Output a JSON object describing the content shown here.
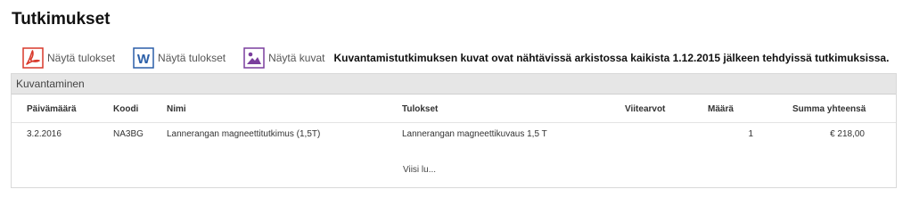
{
  "page": {
    "title": "Tutkimukset"
  },
  "actions": {
    "pdf_results": {
      "label": "Näytä tulokset",
      "icon": "pdf-icon",
      "color": "#d9392b"
    },
    "word_results": {
      "label": "Näytä tulokset",
      "icon": "word-icon",
      "color": "#2b5fa8"
    },
    "images": {
      "label": "Näytä kuvat",
      "icon": "image-icon",
      "color": "#7a3e9d"
    },
    "notice": "Kuvantamistutkimuksen kuvat ovat nähtävissä arkistossa kaikista 1.12.2015 jälkeen tehdyissä tutkimuksissa."
  },
  "panel": {
    "title": "Kuvantaminen",
    "columns": {
      "date": "Päivämäärä",
      "code": "Koodi",
      "name": "Nimi",
      "results": "Tulokset",
      "reference": "Viitearvot",
      "quantity": "Määrä",
      "total": "Summa yhteensä"
    },
    "rows": [
      {
        "date": "3.2.2016",
        "code": "NA3BG",
        "name": "Lannerangan magneettitutkimus (1,5T)",
        "results": "Lannerangan magneettikuvaus 1,5 T",
        "reference": "",
        "quantity": "1",
        "total": "€ 218,00"
      }
    ],
    "more_link": "Viisi lu..."
  }
}
